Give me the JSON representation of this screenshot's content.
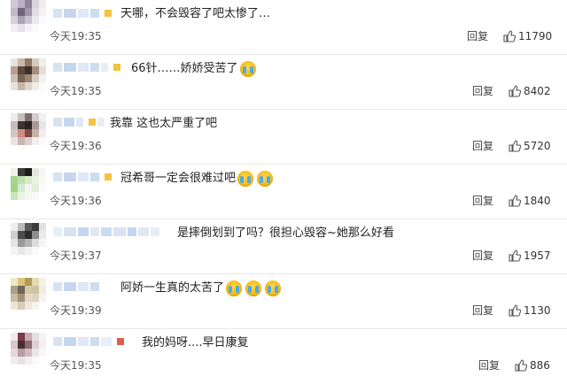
{
  "labels": {
    "reply": "回复"
  },
  "comments": [
    {
      "text": "天哪，不会毁容了吧太惨了…",
      "emoji_count": 0,
      "time": "今天19:35",
      "likes": "11790"
    },
    {
      "text": "66针……娇娇受苦了",
      "emoji_count": 1,
      "time": "今天19:35",
      "likes": "8402"
    },
    {
      "text": "我靠 这也太严重了吧",
      "emoji_count": 0,
      "time": "今天19:36",
      "likes": "5720"
    },
    {
      "text": "冠希哥一定会很难过吧",
      "emoji_count": 2,
      "time": "今天19:36",
      "likes": "1840"
    },
    {
      "text": "是摔倒划到了吗？很担心毁容~她那么好看",
      "emoji_count": 0,
      "time": "今天19:37",
      "likes": "1957"
    },
    {
      "text": "阿娇一生真的太苦了",
      "emoji_count": 3,
      "time": "今天19:39",
      "likes": "1130"
    },
    {
      "text": "我的妈呀....早日康复",
      "emoji_count": 0,
      "time": "今天19:35",
      "likes": "886"
    }
  ],
  "icons": {
    "like": "thumbs-up-icon",
    "cry_emoji": "crying-face-emoji-icon",
    "badge": "vip-badge-icon"
  },
  "colors": {
    "badge": "#f5c242",
    "divider": "#e8e8e8",
    "time_text": "#555555",
    "body_text": "#222222"
  }
}
